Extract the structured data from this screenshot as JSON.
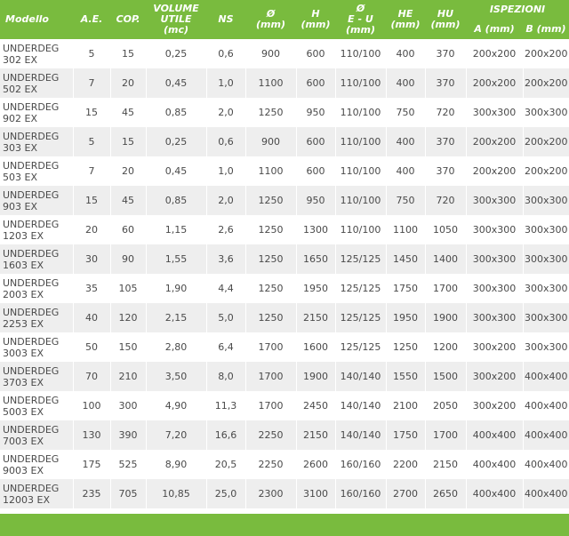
{
  "colors": {
    "header_bg": "#79bb3e",
    "header_text": "#ffffff",
    "row_alt": "#eeeeee",
    "text": "#4a4a4a"
  },
  "header": {
    "modello": "Modello",
    "ae": "A.E.",
    "cop": "COP.",
    "volume": [
      "VOLUME",
      "UTILE",
      "(mc)"
    ],
    "ns": "NS",
    "diam": [
      "Ø",
      "(mm)"
    ],
    "h": [
      "H",
      "(mm)"
    ],
    "eu": [
      "Ø",
      "E - U",
      "(mm)"
    ],
    "he": [
      "HE",
      "(mm)"
    ],
    "hu": [
      "HU",
      "(mm)"
    ],
    "ispezioni": "ISPEZIONI",
    "a": "A (mm)",
    "b": "B (mm)"
  },
  "rows": [
    [
      "UNDERDEG 302 EX",
      "5",
      "15",
      "0,25",
      "0,6",
      "900",
      "600",
      "110/100",
      "400",
      "370",
      "200x200",
      "200x200"
    ],
    [
      "UNDERDEG 502 EX",
      "7",
      "20",
      "0,45",
      "1,0",
      "1100",
      "600",
      "110/100",
      "400",
      "370",
      "200x200",
      "200x200"
    ],
    [
      "UNDERDEG 902 EX",
      "15",
      "45",
      "0,85",
      "2,0",
      "1250",
      "950",
      "110/100",
      "750",
      "720",
      "300x300",
      "300x300"
    ],
    [
      "UNDERDEG 303 EX",
      "5",
      "15",
      "0,25",
      "0,6",
      "900",
      "600",
      "110/100",
      "400",
      "370",
      "200x200",
      "200x200"
    ],
    [
      "UNDERDEG 503 EX",
      "7",
      "20",
      "0,45",
      "1,0",
      "1100",
      "600",
      "110/100",
      "400",
      "370",
      "200x200",
      "200x200"
    ],
    [
      "UNDERDEG 903 EX",
      "15",
      "45",
      "0,85",
      "2,0",
      "1250",
      "950",
      "110/100",
      "750",
      "720",
      "300x300",
      "300x300"
    ],
    [
      "UNDERDEG 1203 EX",
      "20",
      "60",
      "1,15",
      "2,6",
      "1250",
      "1300",
      "110/100",
      "1100",
      "1050",
      "300x300",
      "300x300"
    ],
    [
      "UNDERDEG 1603 EX",
      "30",
      "90",
      "1,55",
      "3,6",
      "1250",
      "1650",
      "125/125",
      "1450",
      "1400",
      "300x300",
      "300x300"
    ],
    [
      "UNDERDEG 2003 EX",
      "35",
      "105",
      "1,90",
      "4,4",
      "1250",
      "1950",
      "125/125",
      "1750",
      "1700",
      "300x300",
      "300x300"
    ],
    [
      "UNDERDEG 2253 EX",
      "40",
      "120",
      "2,15",
      "5,0",
      "1250",
      "2150",
      "125/125",
      "1950",
      "1900",
      "300x300",
      "300x300"
    ],
    [
      "UNDERDEG 3003 EX",
      "50",
      "150",
      "2,80",
      "6,4",
      "1700",
      "1600",
      "125/125",
      "1250",
      "1200",
      "300x200",
      "300x300"
    ],
    [
      "UNDERDEG 3703 EX",
      "70",
      "210",
      "3,50",
      "8,0",
      "1700",
      "1900",
      "140/140",
      "1550",
      "1500",
      "300x200",
      "400x400"
    ],
    [
      "UNDERDEG 5003 EX",
      "100",
      "300",
      "4,90",
      "11,3",
      "1700",
      "2450",
      "140/140",
      "2100",
      "2050",
      "300x200",
      "400x400"
    ],
    [
      "UNDERDEG 7003 EX",
      "130",
      "390",
      "7,20",
      "16,6",
      "2250",
      "2150",
      "140/140",
      "1750",
      "1700",
      "400x400",
      "400x400"
    ],
    [
      "UNDERDEG 9003 EX",
      "175",
      "525",
      "8,90",
      "20,5",
      "2250",
      "2600",
      "160/160",
      "2200",
      "2150",
      "400x400",
      "400x400"
    ],
    [
      "UNDERDEG 12003 EX",
      "235",
      "705",
      "10,85",
      "25,0",
      "2300",
      "3100",
      "160/160",
      "2700",
      "2650",
      "400x400",
      "400x400"
    ]
  ]
}
